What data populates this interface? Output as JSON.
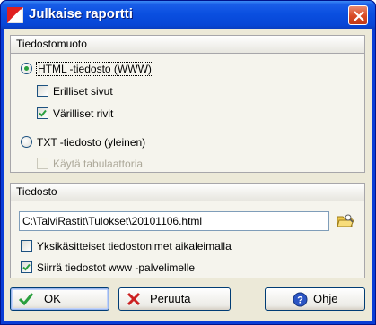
{
  "window": {
    "title": "Julkaise raportti",
    "titlebar_color": "#0a4fe0"
  },
  "format_group": {
    "header": "Tiedostomuoto",
    "html_option": {
      "label": "HTML -tiedosto (WWW)",
      "selected": true
    },
    "separate_pages": {
      "label": "Erilliset sivut",
      "checked": false
    },
    "colored_rows": {
      "label": "Värilliset rivit",
      "checked": true
    },
    "txt_option": {
      "label": "TXT -tiedosto (yleinen)",
      "selected": false
    },
    "use_tab": {
      "label": "Käytä tabulaattoria",
      "checked": false,
      "enabled": false
    }
  },
  "file_group": {
    "header": "Tiedosto",
    "path_value": "C:\\TalviRastit\\Tulokset\\20101106.html",
    "folder_icon": "folder-browse-icon",
    "individual_names": {
      "label": "Yksikäsitteiset tiedostonimet aikaleimalla",
      "checked": false
    },
    "move_to_server": {
      "label": "Siirrä tiedostot www -palvelimelle",
      "checked": true
    }
  },
  "buttons": {
    "ok": "OK",
    "cancel": "Peruuta",
    "help": "Ohje"
  },
  "colors": {
    "check_green": "#2a9f3e",
    "cancel_red": "#cc2222",
    "help_blue": "#2b55c4"
  }
}
